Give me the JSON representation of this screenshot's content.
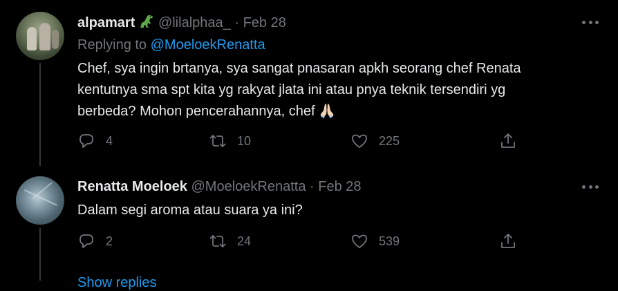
{
  "tweets": [
    {
      "author_name": "alpamart",
      "author_emoji": "dinosaur",
      "handle": "@lilalphaa_",
      "separator": "·",
      "date": "Feb 28",
      "replying_label": "Replying to",
      "replying_to": "@MoeloekRenatta",
      "text_lines": [
        "Chef, sya ingin brtanya, sya sangat pnasaran apkh seorang chef Renata",
        "kentutnya sma spt kita yg rakyat jlata ini atau pnya teknik tersendiri yg",
        "berbeda? Mohon pencerahannya, chef"
      ],
      "text_emoji": "folded-hands",
      "replies": "4",
      "retweets": "10",
      "likes": "225"
    },
    {
      "author_name": "Renatta Moeloek",
      "handle": "@MoeloekRenatta",
      "separator": "·",
      "date": "Feb 28",
      "text_lines": [
        "Dalam segi aroma atau suara ya ini?"
      ],
      "replies": "2",
      "retweets": "24",
      "likes": "539"
    }
  ],
  "show_more_label": "Show replies",
  "colors": {
    "background": "#000000",
    "text": "#e7e9ea",
    "muted": "#71767b",
    "accent": "#1d9bf0",
    "thread_line": "#333639"
  },
  "icons": {
    "reply": "reply-icon",
    "retweet": "retweet-icon",
    "like": "heart-icon",
    "share": "share-icon",
    "more": "more-icon"
  }
}
